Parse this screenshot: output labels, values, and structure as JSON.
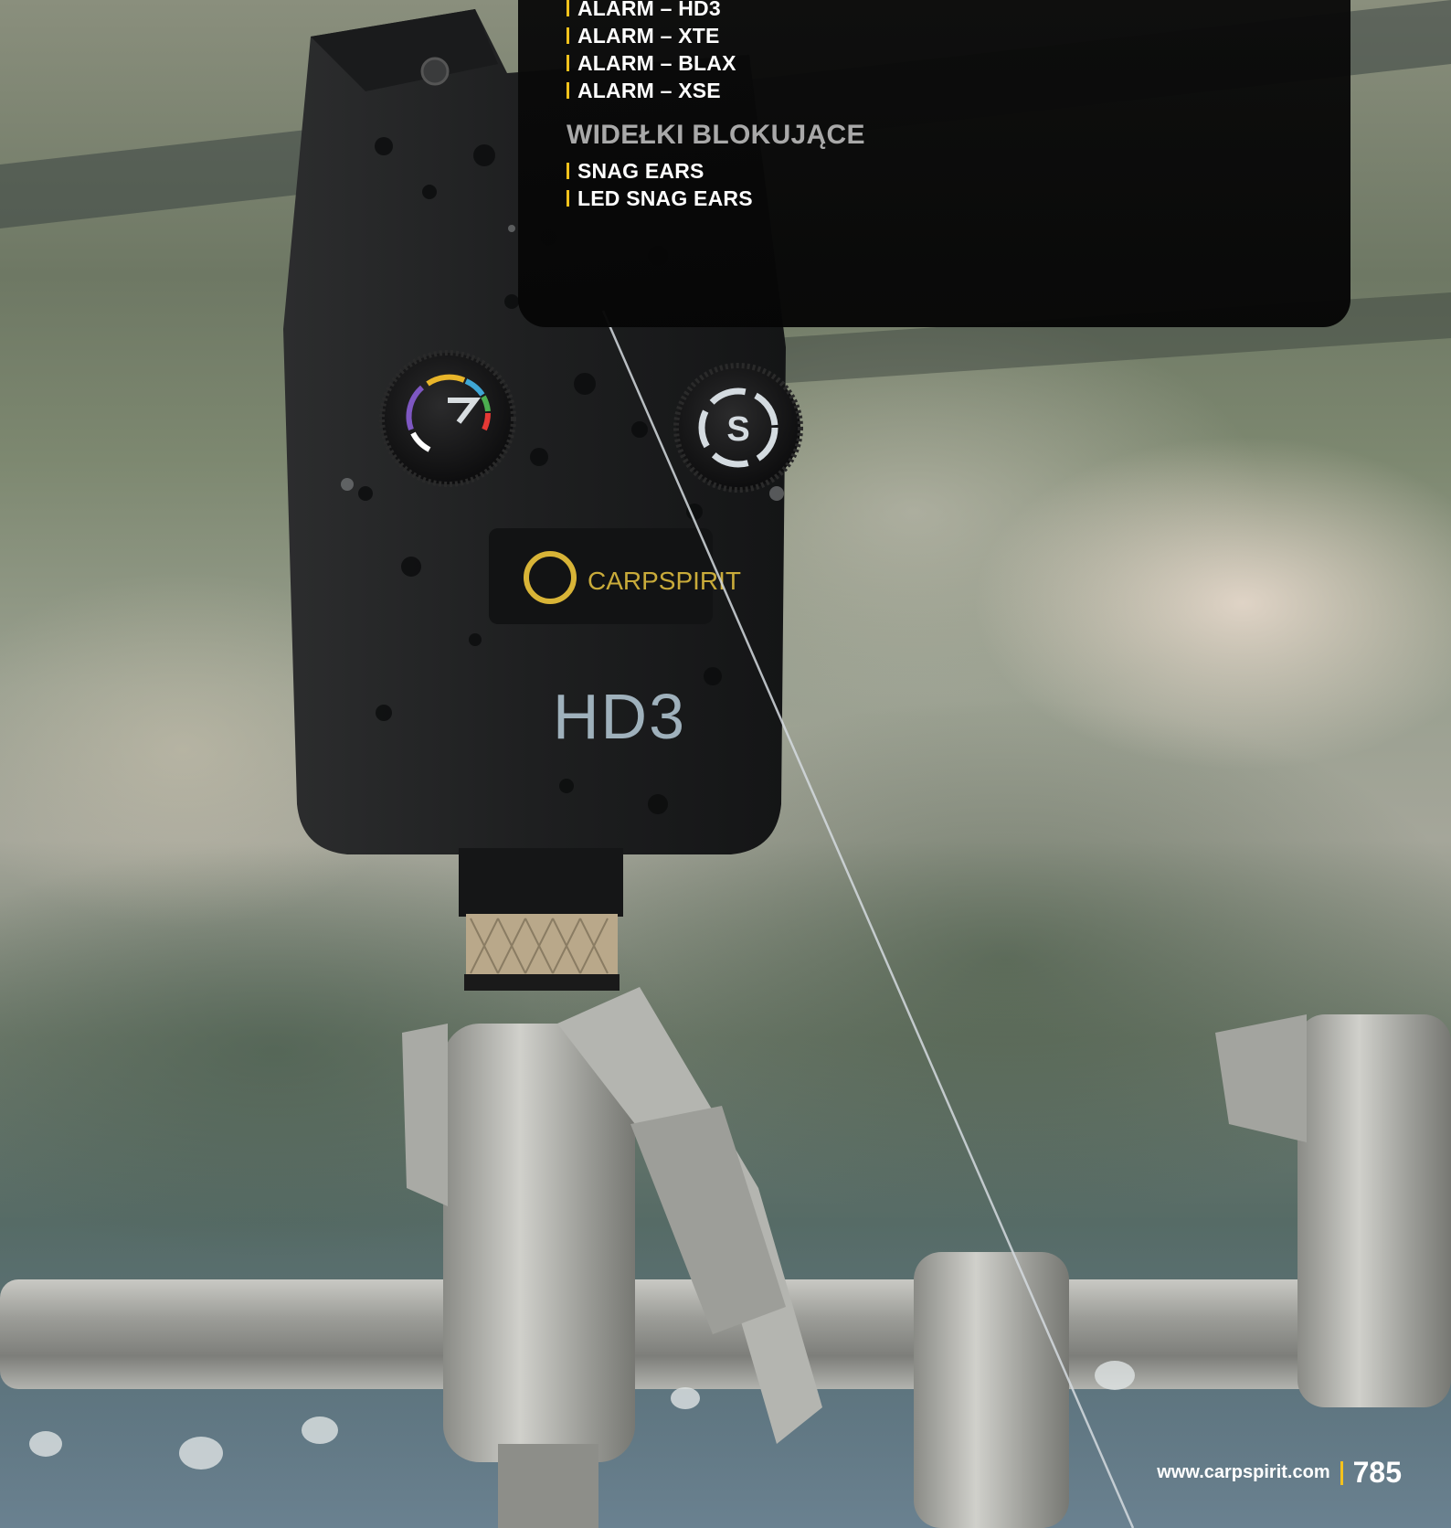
{
  "alarms": {
    "items": [
      "ALARM – HD3",
      "ALARM – XTE",
      "ALARM – BLAX",
      "ALARM – XSE"
    ]
  },
  "snag_ears": {
    "title": "WIDEŁKI BLOKUJĄCE",
    "items": [
      "SNAG EARS",
      "LED SNAG EARS"
    ]
  },
  "photo": {
    "brand_text": "CARPSPIRIT",
    "model_text": "HD3",
    "dial_letter": "S"
  },
  "footer": {
    "url": "www.carpspirit.com",
    "page_number": "785"
  },
  "colors": {
    "accent": "#f4c21c",
    "panel": "#0a0a0a",
    "section_title": "#a9a9a9"
  }
}
